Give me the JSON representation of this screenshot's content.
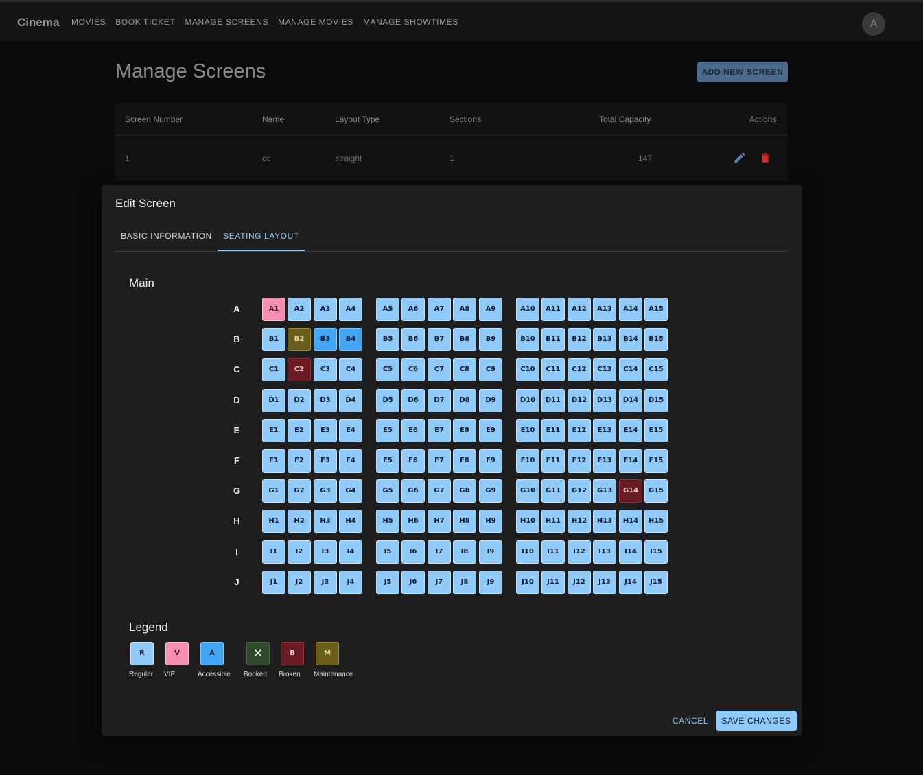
{
  "app": {
    "brand": "Cinema",
    "avatar_initial": "A"
  },
  "nav": {
    "items": [
      "MOVIES",
      "BOOK TICKET",
      "MANAGE SCREENS",
      "MANAGE MOVIES",
      "MANAGE SHOWTIMES"
    ]
  },
  "page": {
    "title": "Manage Screens",
    "add_button": "ADD NEW SCREEN"
  },
  "table": {
    "headers": [
      "Screen Number",
      "Name",
      "Layout Type",
      "Sections",
      "Total Capacity",
      "Actions"
    ],
    "rows": [
      {
        "screen_number": "1",
        "name": "cc",
        "layout_type": "straight",
        "sections": "1",
        "total_capacity": "147"
      }
    ]
  },
  "dialog": {
    "title": "Edit Screen",
    "tabs": [
      "BASIC INFORMATION",
      "SEATING LAYOUT"
    ],
    "active_tab": "SEATING LAYOUT",
    "section_name": "Main",
    "rows": [
      "A",
      "B",
      "C",
      "D",
      "E",
      "F",
      "G",
      "H",
      "I",
      "J"
    ],
    "seats_per_row": 15,
    "aisle_groups": [
      [
        1,
        4
      ],
      [
        5,
        9
      ],
      [
        10,
        15
      ]
    ],
    "seat_types": {
      "A1": "vip",
      "B2": "maintenance",
      "B3": "accessible",
      "B4": "accessible",
      "C2": "broken",
      "G14": "broken"
    },
    "default_seat_type": "regular",
    "legend_title": "Legend",
    "legend": [
      {
        "code": "R",
        "label": "Regular",
        "type": "regular"
      },
      {
        "code": "V",
        "label": "VIP",
        "type": "vip"
      },
      {
        "code": "A",
        "label": "Accessible",
        "type": "accessible"
      },
      {
        "code": "✕",
        "label": "Booked",
        "type": "booked"
      },
      {
        "code": "B",
        "label": "Broken",
        "type": "broken"
      },
      {
        "code": "M",
        "label": "Maintenance",
        "type": "maintenance"
      }
    ],
    "cancel_label": "CANCEL",
    "save_label": "SAVE CHANGES"
  },
  "colors": {
    "regular": "#90caf9",
    "vip": "#f48fb1",
    "accessible": "#42a5f5",
    "booked": "#2e4a2a",
    "broken": "#6a1b24",
    "maintenance": "#6b5e1c",
    "accent": "#90caf9",
    "delete": "#d32f2f",
    "edit": "#5a7fa8"
  }
}
